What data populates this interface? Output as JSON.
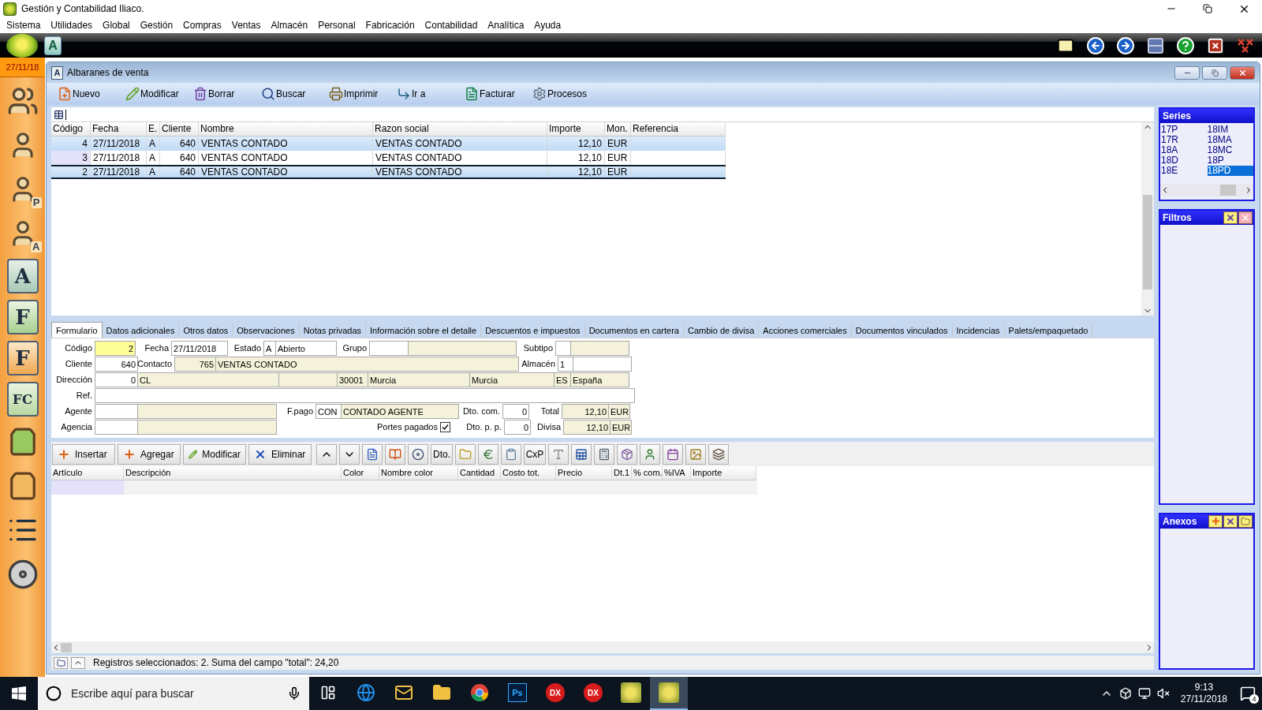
{
  "window": {
    "title": "Gestión y Contabilidad Iliaco."
  },
  "menu": [
    "Sistema",
    "Utilidades",
    "Global",
    "Gestión",
    "Compras",
    "Ventas",
    "Almacén",
    "Personal",
    "Fabricación",
    "Contabilidad",
    "Analítica",
    "Ayuda"
  ],
  "top_bar": {
    "app_letter": "A"
  },
  "sidebar": {
    "date": "27/11/18",
    "items": [
      {
        "kind": "people"
      },
      {
        "kind": "person"
      },
      {
        "kind": "person",
        "letter": "P"
      },
      {
        "kind": "person",
        "letter": "A"
      },
      {
        "kind": "document",
        "letter": "A"
      },
      {
        "kind": "document",
        "letter": "F"
      },
      {
        "kind": "document",
        "letter": "F"
      },
      {
        "kind": "document",
        "letter": "FC"
      },
      {
        "kind": "bag"
      },
      {
        "kind": "bag"
      },
      {
        "kind": "list"
      },
      {
        "kind": "disc"
      }
    ]
  },
  "child_window": {
    "title": "Albaranes de venta",
    "icon_letter": "A"
  },
  "toolbar": [
    "Nuevo",
    "Modificar",
    "Borrar",
    "Buscar",
    "Imprimir",
    "Ir a",
    "Facturar",
    "Procesos"
  ],
  "list": {
    "columns": [
      "Código",
      "Fecha",
      "E.",
      "Cliente",
      "Nombre",
      "Razon social",
      "Importe",
      "Mon.",
      "Referencia"
    ],
    "rows": [
      {
        "cells": [
          "4",
          "27/11/2018",
          "A",
          "640",
          "VENTAS CONTADO",
          "VENTAS CONTADO",
          "12,10",
          "EUR"
        ],
        "selected": true,
        "current": false
      },
      {
        "cells": [
          "3",
          "27/11/2018",
          "A",
          "640",
          "VENTAS CONTADO",
          "VENTAS CONTADO",
          "12,10",
          "EUR"
        ],
        "selected": false,
        "current": false
      },
      {
        "cells": [
          "2",
          "27/11/2018",
          "A",
          "640",
          "VENTAS CONTADO",
          "VENTAS CONTADO",
          "12,10",
          "EUR"
        ],
        "selected": true,
        "current": true
      }
    ]
  },
  "series": {
    "title": "Series",
    "items": [
      {
        "label": "17P",
        "selected": false
      },
      {
        "label": "17R",
        "selected": false
      },
      {
        "label": "18A",
        "selected": false
      },
      {
        "label": "18D",
        "selected": false
      },
      {
        "label": "18E",
        "selected": false
      },
      {
        "label": "18IM",
        "selected": false
      },
      {
        "label": "18MA",
        "selected": false
      },
      {
        "label": "18MC",
        "selected": false
      },
      {
        "label": "18P",
        "selected": false
      },
      {
        "label": "18PD",
        "selected": true
      }
    ]
  },
  "filters": {
    "title": "Filtros"
  },
  "attachments": {
    "title": "Anexos"
  },
  "tabs": [
    {
      "label": "Formulario",
      "selected": true
    },
    {
      "label": "Datos adicionales",
      "selected": false
    },
    {
      "label": "Otros datos",
      "selected": false
    },
    {
      "label": "Observaciones",
      "selected": false
    },
    {
      "label": "Notas privadas",
      "selected": false
    },
    {
      "label": "Información sobre el detalle",
      "selected": false
    },
    {
      "label": "Descuentos e impuestos",
      "selected": false
    },
    {
      "label": "Documentos en cartera",
      "selected": false
    },
    {
      "label": "Cambio de divisa",
      "selected": false
    },
    {
      "label": "Acciones comerciales",
      "selected": false
    },
    {
      "label": "Documentos vinculados",
      "selected": false
    },
    {
      "label": "Incidencias",
      "selected": false
    },
    {
      "label": "Palets/empaquetado",
      "selected": false
    }
  ],
  "form": {
    "lines": [
      {
        "groups": [
          {
            "label": "Código",
            "boxes": [
              {
                "kind": "highlight-num",
                "text": "2"
              }
            ]
          },
          {
            "label": "Fecha",
            "boxes": [
              {
                "kind": "input",
                "text": "27/11/2018"
              }
            ]
          },
          {
            "label": "Estado",
            "boxes": [
              {
                "kind": "input",
                "text": "A"
              },
              {
                "kind": "input",
                "text": "Abierto"
              }
            ]
          },
          {
            "label": "Grupo",
            "boxes": [
              {
                "kind": "input"
              },
              {
                "kind": "readonly"
              }
            ]
          },
          {
            "label": "Subtipo",
            "boxes": [
              {
                "kind": "input"
              },
              {
                "kind": "readonly"
              }
            ]
          }
        ]
      },
      {
        "groups": [
          {
            "label": "Cliente",
            "boxes": [
              {
                "kind": "input-num",
                "text": "640"
              }
            ]
          },
          {
            "label": "Contacto",
            "boxes": [
              {
                "kind": "readonly-num",
                "text": "765"
              },
              {
                "kind": "readonly",
                "text": "VENTAS CONTADO"
              }
            ]
          },
          {
            "label": "Almacén",
            "boxes": [
              {
                "kind": "input",
                "text": "1"
              },
              {
                "kind": "input"
              }
            ]
          }
        ]
      },
      {
        "groups": [
          {
            "label": "Dirección",
            "boxes": [
              {
                "kind": "input-num",
                "text": "0"
              },
              {
                "kind": "readonly",
                "text": "CL"
              },
              {
                "kind": "readonly"
              },
              {
                "kind": "readonly",
                "text": "30001"
              },
              {
                "kind": "readonly",
                "text": "Murcia"
              },
              {
                "kind": "readonly",
                "text": "Murcia"
              },
              {
                "kind": "readonly",
                "text": "ES"
              },
              {
                "kind": "readonly",
                "text": "España"
              }
            ]
          }
        ]
      },
      {
        "groups": [
          {
            "label": "Ref.",
            "boxes": [
              {
                "kind": "input"
              }
            ]
          }
        ]
      },
      {
        "groups": [
          {
            "label": "Agente",
            "boxes": [
              {
                "kind": "input"
              },
              {
                "kind": "readonly"
              }
            ]
          },
          {
            "label": "F.pago",
            "boxes": [
              {
                "kind": "input",
                "text": "CON"
              },
              {
                "kind": "readonly",
                "text": "CONTADO AGENTE"
              }
            ]
          },
          {
            "label": "Dto. com.",
            "boxes": [
              {
                "kind": "input-num",
                "text": "0"
              }
            ]
          },
          {
            "label": "Total",
            "boxes": [
              {
                "kind": "readonly-num",
                "text": "12,10"
              },
              {
                "kind": "readonly",
                "text": "EUR"
              }
            ]
          }
        ]
      },
      {
        "groups": [
          {
            "label": "Agencia",
            "boxes": [
              {
                "kind": "input"
              },
              {
                "kind": "readonly"
              }
            ]
          },
          {
            "label": "Portes pagados",
            "boxes": [
              {
                "kind": "check",
                "checked": true
              }
            ]
          },
          {
            "label": "Dto. p. p.",
            "boxes": [
              {
                "kind": "input-num",
                "text": "0"
              }
            ]
          },
          {
            "label": "Divisa",
            "boxes": [
              {
                "kind": "readonly-num",
                "text": "12,10"
              },
              {
                "kind": "readonly",
                "text": "EUR"
              }
            ]
          }
        ]
      }
    ]
  },
  "detail_toolbar": [
    {
      "kind": "labeled",
      "label": "Insertar"
    },
    {
      "kind": "labeled",
      "label": "Agregar"
    },
    {
      "kind": "labeled",
      "label": "Modificar"
    },
    {
      "kind": "labeled",
      "label": "Eliminar"
    },
    {
      "kind": "icon"
    },
    {
      "kind": "icon"
    },
    {
      "kind": "icon"
    },
    {
      "kind": "icon"
    },
    {
      "kind": "icon"
    },
    {
      "kind": "text",
      "label": "Dto."
    },
    {
      "kind": "icon"
    },
    {
      "kind": "icon"
    },
    {
      "kind": "icon"
    },
    {
      "kind": "text",
      "label": "CxP"
    },
    {
      "kind": "icon"
    },
    {
      "kind": "icon"
    },
    {
      "kind": "icon"
    },
    {
      "kind": "icon"
    },
    {
      "kind": "icon"
    },
    {
      "kind": "icon"
    },
    {
      "kind": "icon"
    },
    {
      "kind": "icon"
    }
  ],
  "detail_grid": {
    "columns": [
      "Artículo",
      "Descripción",
      "Color",
      "Nombre color",
      "Cantidad",
      "Costo tot.",
      "Precio",
      "Dt.1",
      "% com.",
      "%IVA",
      "Importe"
    ]
  },
  "status_bar": {
    "text": "Registros seleccionados: 2. Suma del campo \"total\": 24,20"
  },
  "taskbar": {
    "search_placeholder": "Escribe aquí para buscar",
    "apps": [
      {
        "kind": "browser",
        "active": false
      },
      {
        "kind": "mail",
        "active": false
      },
      {
        "kind": "folder",
        "active": false
      },
      {
        "kind": "chrome",
        "active": false
      },
      {
        "kind": "tile",
        "letter": "Ps",
        "active": false
      },
      {
        "kind": "round",
        "letter": "DX",
        "active": false
      },
      {
        "kind": "round",
        "letter": "DX",
        "active": false
      },
      {
        "kind": "app",
        "active": false
      },
      {
        "kind": "app",
        "active": true
      }
    ],
    "time": "9:13",
    "date": "27/11/2018",
    "notifications": "4"
  }
}
